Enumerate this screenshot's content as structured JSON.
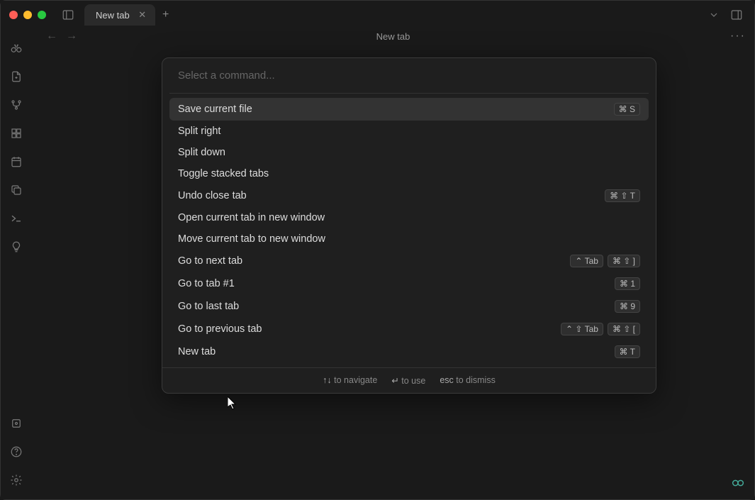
{
  "titlebar": {
    "tab_label": "New tab"
  },
  "content": {
    "nav_back": "←",
    "nav_fwd": "→",
    "title": "New tab",
    "more": "···"
  },
  "palette": {
    "placeholder": "Select a command...",
    "items": [
      {
        "label": "Save current file",
        "shortcuts": [
          "⌘ S"
        ],
        "selected": true
      },
      {
        "label": "Split right",
        "shortcuts": []
      },
      {
        "label": "Split down",
        "shortcuts": []
      },
      {
        "label": "Toggle stacked tabs",
        "shortcuts": []
      },
      {
        "label": "Undo close tab",
        "shortcuts": [
          "⌘ ⇧ T"
        ]
      },
      {
        "label": "Open current tab in new window",
        "shortcuts": []
      },
      {
        "label": "Move current tab to new window",
        "shortcuts": []
      },
      {
        "label": "Go to next tab",
        "shortcuts": [
          "⌃ Tab",
          "⌘ ⇧ ]"
        ]
      },
      {
        "label": "Go to tab #1",
        "shortcuts": [
          "⌘ 1"
        ]
      },
      {
        "label": "Go to last tab",
        "shortcuts": [
          "⌘ 9"
        ]
      },
      {
        "label": "Go to previous tab",
        "shortcuts": [
          "⌃ ⇧ Tab",
          "⌘ ⇧ ["
        ]
      },
      {
        "label": "New tab",
        "shortcuts": [
          "⌘ T"
        ]
      }
    ],
    "footer": {
      "nav_keys": "↑↓",
      "nav_text": " to navigate",
      "use_keys": "↵",
      "use_text": " to use",
      "esc_keys": "esc",
      "esc_text": " to dismiss"
    }
  }
}
